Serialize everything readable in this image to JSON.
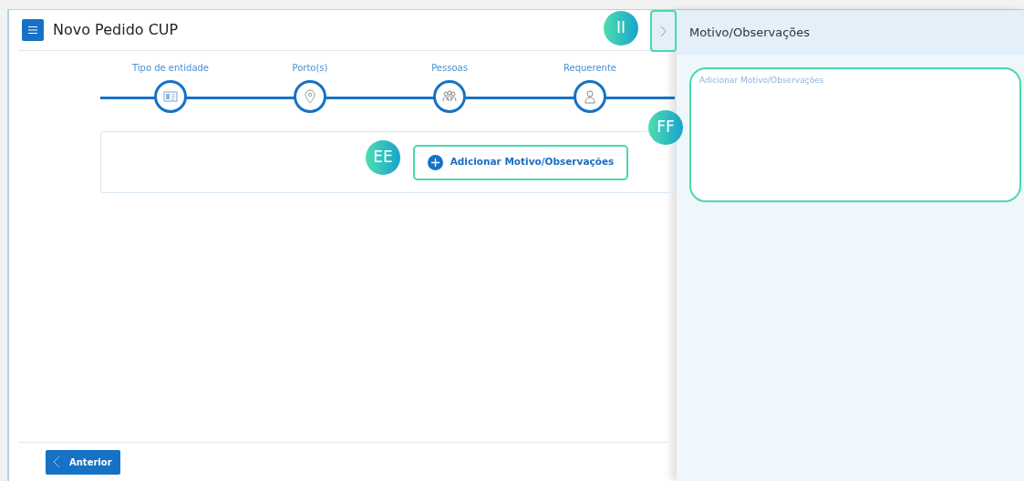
{
  "header": {
    "title": "Novo Pedido CUP"
  },
  "steps": [
    {
      "label": "Tipo de entidade",
      "kind": "id-card"
    },
    {
      "label": "Porto(s)",
      "kind": "pin"
    },
    {
      "label": "Pessoas",
      "kind": "people"
    },
    {
      "label": "Requerente",
      "kind": "person"
    }
  ],
  "add_button": {
    "label": "Adicionar Motivo/Observações",
    "highlighted": true,
    "marker": "EE"
  },
  "nav": {
    "previous": "Anterior"
  },
  "panel": {
    "title": "Motivo/Observações",
    "field": {
      "placeholder": "Adicionar Motivo/Observações",
      "highlighted": true,
      "marker": "FF"
    },
    "toggle": {
      "highlighted": true,
      "marker": "II"
    }
  }
}
